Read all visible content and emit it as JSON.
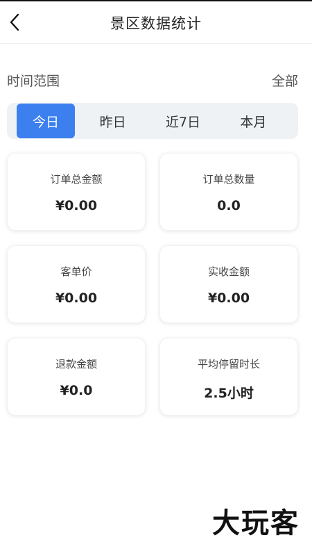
{
  "header": {
    "title": "景区数据统计"
  },
  "time_range": {
    "label": "时间范围",
    "scope": "全部"
  },
  "tabs": [
    {
      "label": "今日",
      "active": true
    },
    {
      "label": "昨日",
      "active": false
    },
    {
      "label": "近7日",
      "active": false
    },
    {
      "label": "本月",
      "active": false
    }
  ],
  "stats": [
    {
      "label": "订单总金额",
      "value": "¥0.00"
    },
    {
      "label": "订单总数量",
      "value": "0.0"
    },
    {
      "label": "客单价",
      "value": "¥0.00"
    },
    {
      "label": "实收金额",
      "value": "¥0.00"
    },
    {
      "label": "退款金额",
      "value": "¥0.0"
    },
    {
      "label": "平均停留时长",
      "value": "2.5小时"
    }
  ],
  "watermark": "大玩客",
  "colors": {
    "accent": "#3c80f0",
    "tabs_bg": "#eff2f5"
  },
  "icons": {
    "back": "chevron-left-icon"
  }
}
